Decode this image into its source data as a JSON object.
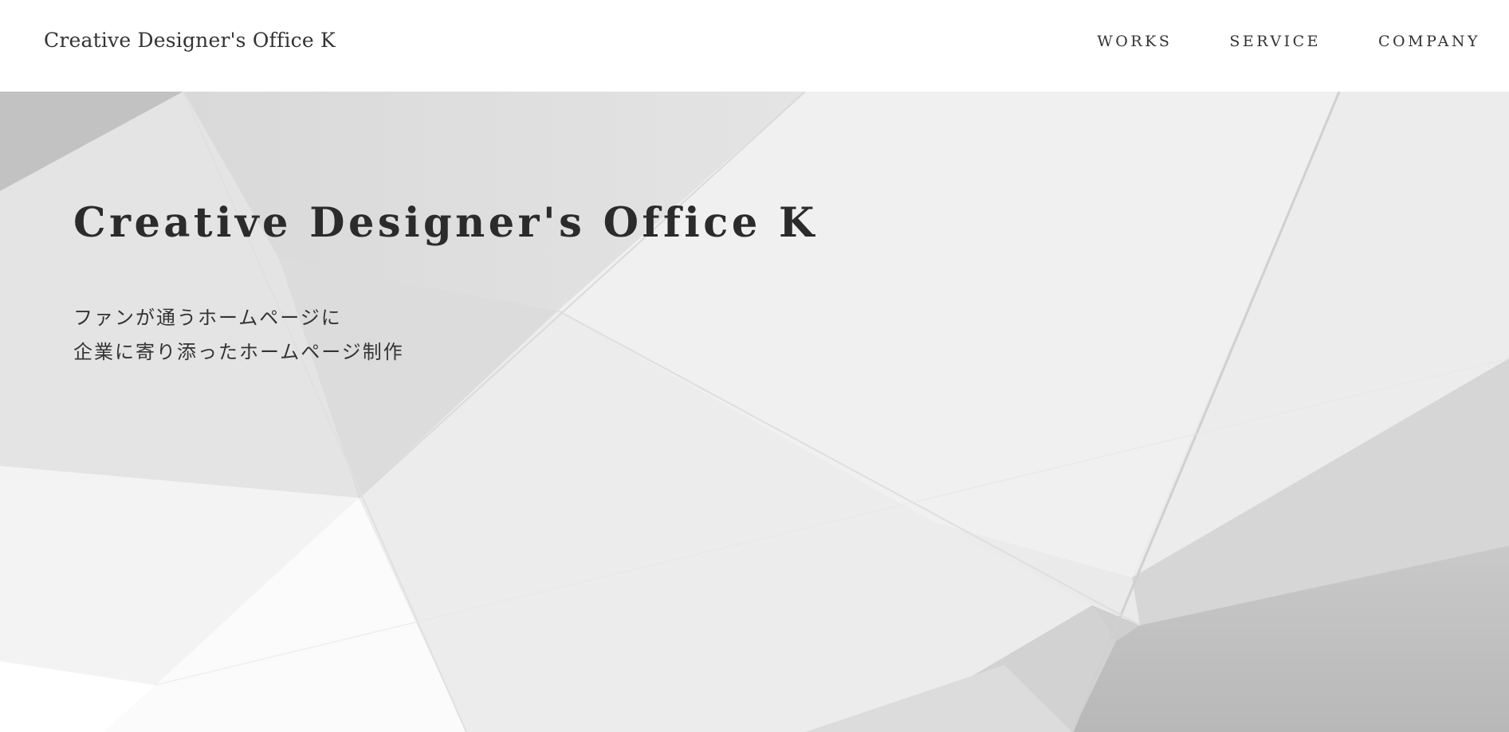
{
  "header": {
    "logo": "Creative Designer's Office K",
    "nav": [
      {
        "label": "WORKS"
      },
      {
        "label": "SERVICE"
      },
      {
        "label": "COMPANY"
      }
    ]
  },
  "hero": {
    "title": "Creative Designer's Office K",
    "subtitle_lines": [
      "ファンが通うホームページに",
      "企業に寄り添ったホームページ制作"
    ]
  },
  "colors": {
    "text": "#333333",
    "header_bg": "#ffffff",
    "hero_base": "#e9e9e9"
  }
}
